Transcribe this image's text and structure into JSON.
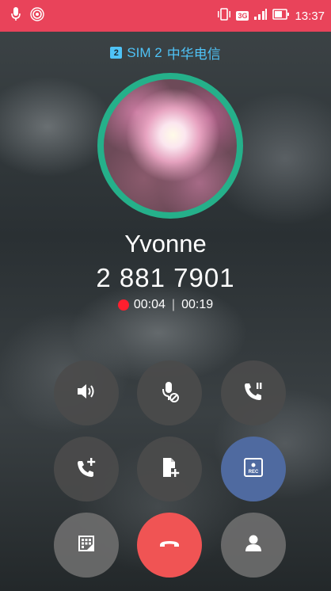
{
  "status_bar": {
    "left_icons": [
      "mic-icon",
      "hotspot-icon"
    ],
    "network_type": "3G",
    "time": "13:37"
  },
  "call": {
    "sim_badge": "2",
    "sim_label": "SIM 2",
    "carrier": "中华电信",
    "contact_name": "Yvonne",
    "phone_number": "2 881 7901",
    "recording_time": "00:04",
    "call_duration": "00:19"
  },
  "buttons": [
    {
      "id": "speaker",
      "icon": "speaker-icon"
    },
    {
      "id": "mute",
      "icon": "mic-off-icon"
    },
    {
      "id": "hold",
      "icon": "call-hold-icon"
    },
    {
      "id": "add-call",
      "icon": "add-call-icon"
    },
    {
      "id": "add-note",
      "icon": "add-note-icon"
    },
    {
      "id": "record",
      "icon": "rec-icon",
      "label": "REC"
    },
    {
      "id": "keypad",
      "icon": "keypad-icon"
    },
    {
      "id": "end-call",
      "icon": "end-call-icon"
    },
    {
      "id": "contacts",
      "icon": "contact-icon"
    }
  ],
  "colors": {
    "status_bar": "#e9435a",
    "avatar_ring": "#25b08a",
    "record_button": "#4f6aa0",
    "end_call": "#f05454",
    "recording_dot": "#ff1f2e",
    "sim_text": "#4fc3f7"
  }
}
